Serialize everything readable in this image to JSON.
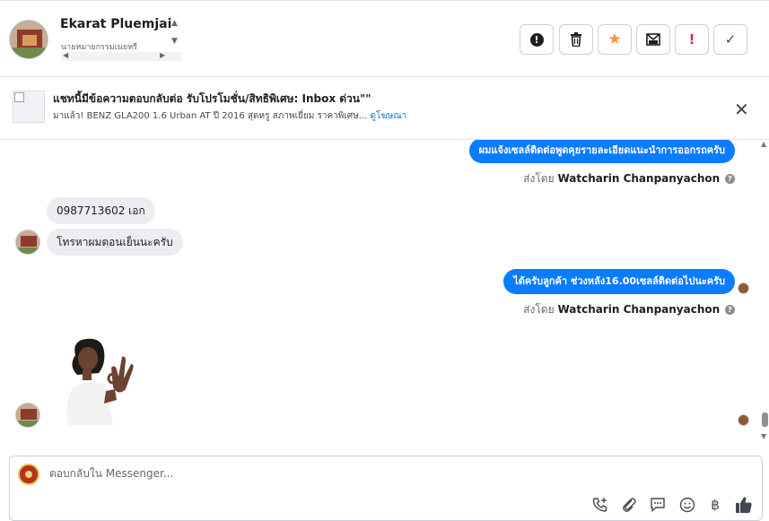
{
  "header": {
    "contact_name": "Ekarat Pluemjai",
    "contact_subtitle": "นายหมายกรรมเนยหรี",
    "actions": [
      {
        "icon": "alert-circle-icon",
        "glyph": "!"
      },
      {
        "icon": "trash-icon",
        "glyph": "🗑"
      },
      {
        "icon": "star-icon",
        "glyph": "★"
      },
      {
        "icon": "mark-unread-icon",
        "glyph": "✉"
      },
      {
        "icon": "follow-up-icon",
        "glyph": "!"
      },
      {
        "icon": "done-check-icon",
        "glyph": "✓"
      }
    ]
  },
  "ad": {
    "title": "แชทนี้มีข้อความตอบกลับต่อ รับโปรโมชั่น/สิทธิพิเศษ: Inbox ด่วน\"\"",
    "description": "มาแล้ว! BENZ GLA200 1.6 Urban AT ปี 2016 สุดหรู สภาพเยี่ยม ราคาพิเศษ...",
    "link": "ดูโฆษณา"
  },
  "messages": {
    "out1": "ผมแจ้งเซลล์ติดต่อพูดคุยรายละเอียดแนะนำการออกรถครับ",
    "sent_by_prefix": "ส่งโดย",
    "sent_by_name": "Watcharin Chanpanyachon",
    "in1": "0987713602 เอก",
    "in2": "โทรหาผมตอนเย็นนะครับ",
    "out2": "ได้ครับลูกค้า ช่วงหลัง16.00เซลล์ติดต่อไปนะครับ"
  },
  "composer": {
    "placeholder": "ตอบกลับใน Messenger..."
  },
  "colors": {
    "accent": "#0a7cff",
    "star": "#f7923a",
    "alert": "#e41e3f"
  }
}
